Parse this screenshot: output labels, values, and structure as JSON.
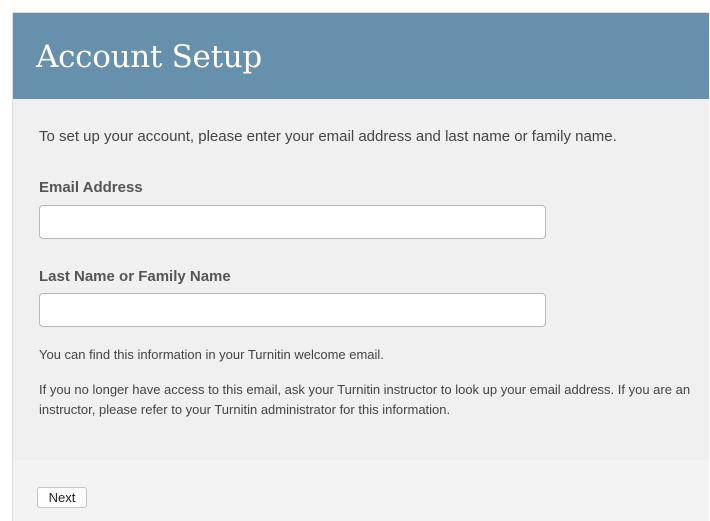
{
  "header": {
    "title": "Account Setup"
  },
  "form": {
    "intro": "To set up your account, please enter your email address and last name or family name.",
    "email": {
      "label": "Email Address",
      "value": "",
      "placeholder": ""
    },
    "last_name": {
      "label": "Last Name or Family Name",
      "value": "",
      "placeholder": ""
    },
    "help_find": "You can find this information in your Turnitin welcome email.",
    "help_access": "If you no longer have access to this email, ask your Turnitin instructor to look up your email address. If you are an instructor, please refer to your Turnitin administrator for this information."
  },
  "footer": {
    "next_label": "Next"
  },
  "colors": {
    "header_background": "#6690ab",
    "panel_background": "#f0f0f0"
  }
}
